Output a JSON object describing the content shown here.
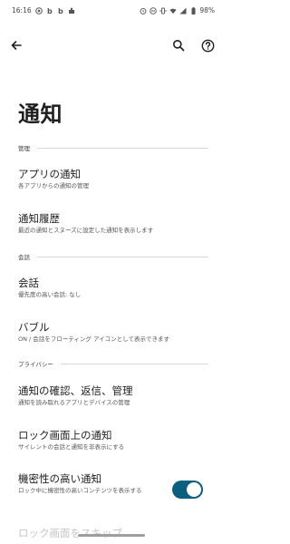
{
  "status_bar": {
    "time": "16:16",
    "battery": "98%",
    "left_icons": [
      "notification-icon",
      "b-app-icon",
      "b-app-icon",
      "puzzle-icon"
    ],
    "right_icons": [
      "alarm-icon",
      "dnd-icon",
      "vibrate-icon",
      "wifi-icon",
      "signal-icon",
      "battery-icon"
    ]
  },
  "toolbar": {
    "back_icon": "arrow-back-icon",
    "search_icon": "search-icon",
    "help_icon": "help-icon"
  },
  "page_title": "通知",
  "sections": {
    "manage": "管理",
    "conversations": "会話",
    "privacy": "プライバシー"
  },
  "items": {
    "app_notifications": {
      "title": "アプリの通知",
      "subtitle": "各アプリからの通知の管理"
    },
    "notification_history": {
      "title": "通知履歴",
      "subtitle": "最近の通知とスヌーズに設定した通知を表示します"
    },
    "conversations": {
      "title": "会話",
      "subtitle": "優先度の高い会話: なし"
    },
    "bubbles": {
      "title": "バブル",
      "subtitle": "ON / 会話をフローティング アイコンとして表示できます"
    },
    "notification_access": {
      "title": "通知の確認、返信、管理",
      "subtitle": "通知を読み取れるアプリとデバイスの管理"
    },
    "lock_screen": {
      "title": "ロック画面上の通知",
      "subtitle": "サイレントの会話と通知を非表示にする"
    },
    "sensitive": {
      "title": "機密性の高い通知",
      "subtitle": "ロック中に機密性の高いコンテンツを表示する",
      "enabled": true
    },
    "skip_lock_screen": {
      "title": "ロック画面をスキップ"
    }
  },
  "colors": {
    "toggle_track": "#0b5f7f",
    "toggle_thumb": "#ffffff"
  }
}
